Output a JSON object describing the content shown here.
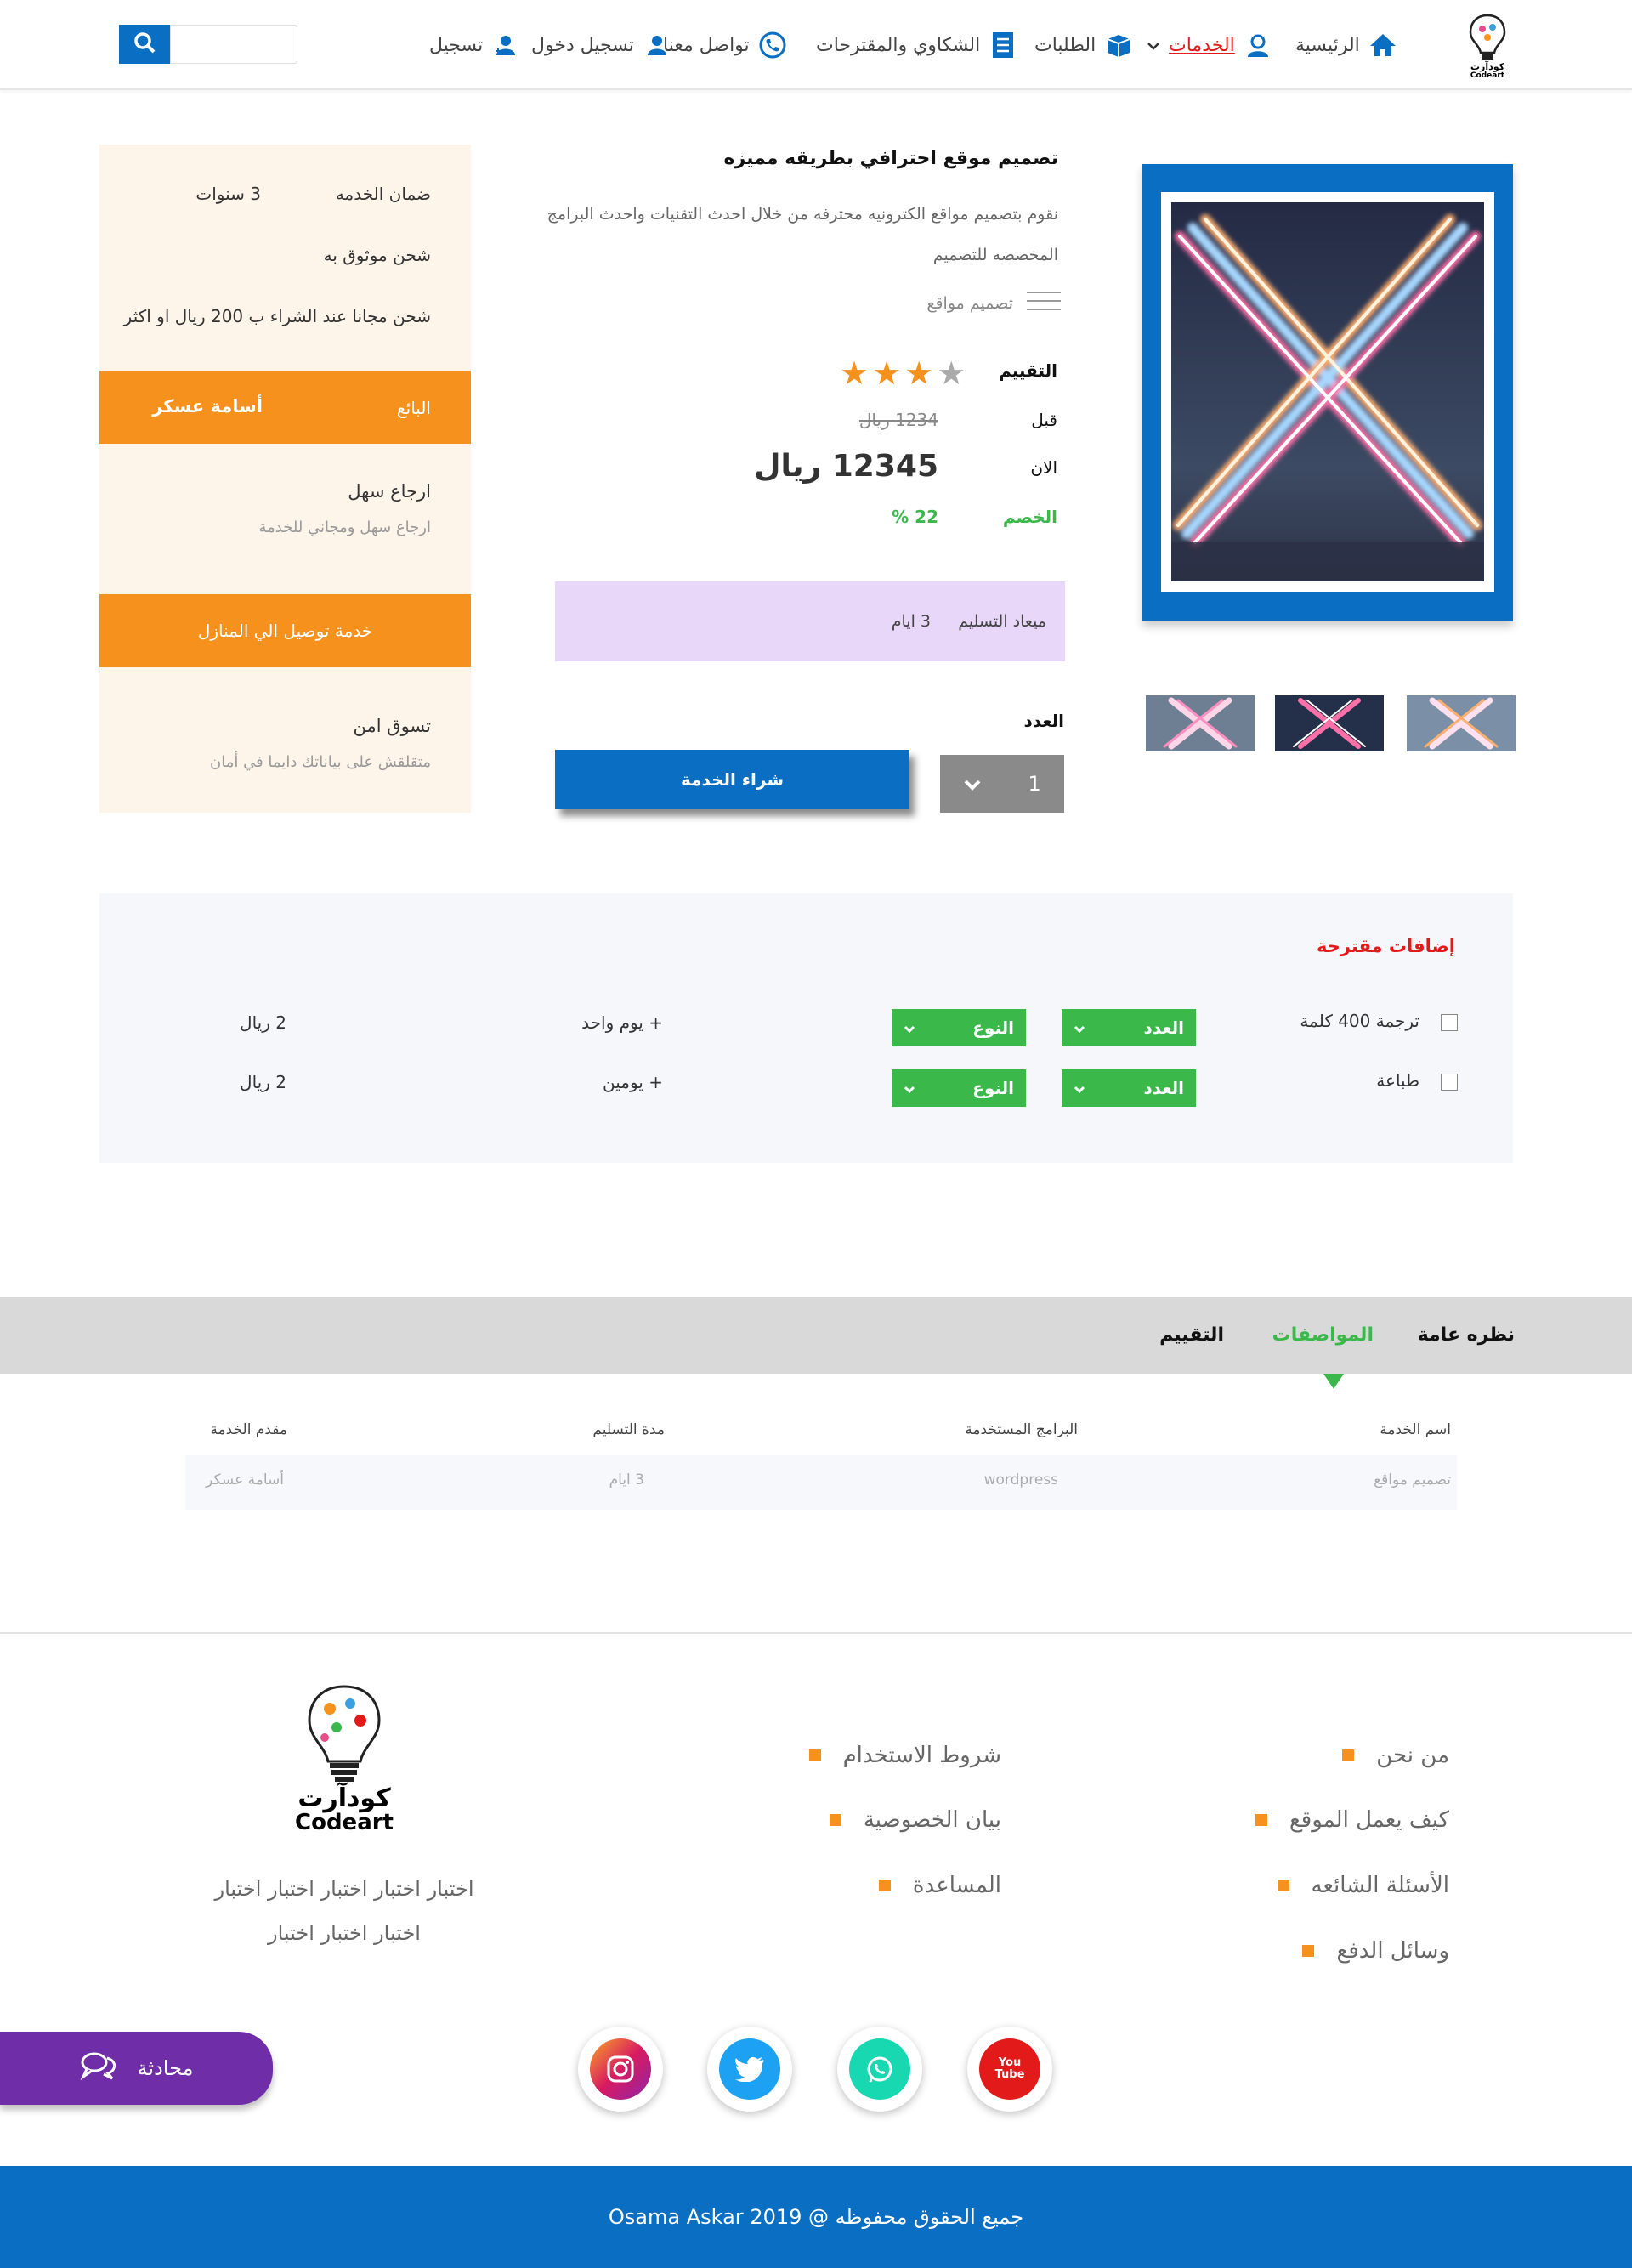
{
  "header": {
    "logo_text": "كودآرت Codeart",
    "nav": {
      "home": "الرئيسية",
      "services": "الخدمات",
      "orders": "الطلبات",
      "complaints": "الشكاوي والمقترحات",
      "contact": "تواصل معنا",
      "login": "تسجيل دخول",
      "register": "تسجيل"
    },
    "search": {
      "placeholder": ""
    }
  },
  "product": {
    "title": "تصميم موقع احترافي  بطريقه مميزه",
    "description": "نقوم بتصميم مواقع الكترونيه محترفه من خلال احدث التقنيات واحدث البرامج المخصصه للتصميم",
    "category": "تصميم مواقع",
    "rating_label": "التقييم",
    "rating": 3,
    "rating_max": 4,
    "before_label": "قبل",
    "before_price": "1234 ريال",
    "now_label": "الان",
    "now_price": "12345 ريال",
    "discount_label": "الخصم",
    "discount_value": "22 %",
    "delivery_label": "ميعاد التسليم",
    "delivery_value": "3   ايام",
    "qty_label": "العدد",
    "qty_value": "1",
    "buy_label": "شراء الخدمة"
  },
  "side_panel": {
    "warranty_label": "ضمان الخدمه",
    "warranty_value": "3    سنوات",
    "trusted_shipping": "شحن موثوق به",
    "free_shipping": "شحن مجانا عند الشراء ب 200 ريال او اكثر",
    "seller_label": "البائع",
    "seller_name": "أسامة عسكر",
    "return_title": "ارجاع سهل",
    "return_sub": "ارجاع سهل ومجاني للخدمة",
    "home_delivery": "خدمة توصيل الي المنازل",
    "safe_title": "تسوق امن",
    "safe_sub": "متقلقش على بياناتك دايما في أمان"
  },
  "addons": {
    "title": "إضافات مقترحة",
    "rows": [
      {
        "name": "ترجمة 400 كلمة",
        "count_label": "العدد",
        "type_label": "النوع",
        "duration": "+   يوم  واحد",
        "price": "2   ريال"
      },
      {
        "name": "طباعة",
        "count_label": "العدد",
        "type_label": "النوع",
        "duration": "+   يومين",
        "price": "2   ريال"
      }
    ]
  },
  "tabs": {
    "overview": "نظره عامة",
    "specs": "المواصفات",
    "reviews": "التقييم"
  },
  "specs": {
    "headers": [
      "اسم الخدمة",
      "البرامج المستخدمة",
      "مدة التسليم",
      "مقدم الخدمة"
    ],
    "values": [
      "تصميم مواقع",
      "wordpress",
      "3   ايام",
      "أسامة عسكر"
    ]
  },
  "footer": {
    "col1": [
      "من نحن",
      "كيف يعمل الموقع",
      "الأسئلة الشائعه",
      "وسائل الدفع"
    ],
    "col2": [
      "شروط الاستخدام",
      "بيان الخصوصية",
      "المساعدة"
    ],
    "logo_ar": "كودآرت",
    "logo_en": "Codeart",
    "about_line1": "اختبار اختبار اختبار اختبار اختبار",
    "about_line2": "اختبار اختبار اختبار",
    "social": [
      "youtube-icon",
      "whatsapp-icon",
      "twitter-icon",
      "instagram-icon"
    ],
    "youtube_text": "You Tube",
    "chat_label": "محادثة",
    "copyright": "جميع الحقوق محفوظه @  2019  Osama Askar"
  },
  "colors": {
    "primary": "#0a6fc2",
    "orange": "#f7911e",
    "green": "#3ab84a",
    "red": "#e21a1a",
    "purple": "#6f2da8"
  }
}
